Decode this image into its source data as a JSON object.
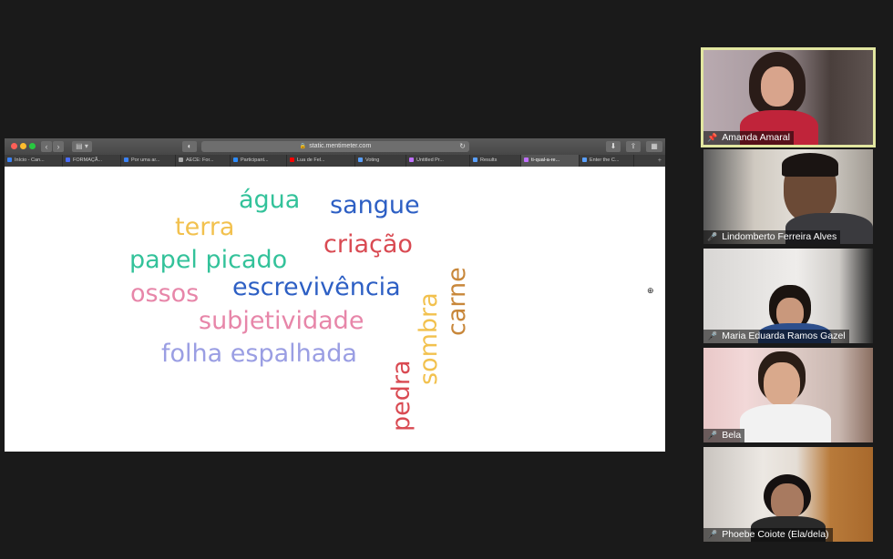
{
  "browser": {
    "url": "static.mentimeter.com",
    "tabs": [
      {
        "label": "Início - Can...",
        "color": "#3b82f6",
        "width": 64
      },
      {
        "label": "FORMAÇÃ...",
        "color": "#4a6cf7",
        "width": 64
      },
      {
        "label": "Por uma ar...",
        "color": "#3b82f6",
        "width": 60
      },
      {
        "label": "AECE: For...",
        "color": "#aaaaaa",
        "width": 60
      },
      {
        "label": "Participant...",
        "color": "#2d8cff",
        "width": 62
      },
      {
        "label": "Lua de Fel...",
        "color": "#ff0000",
        "width": 75
      },
      {
        "label": "Voting",
        "color": "#5aa0ff",
        "width": 56
      },
      {
        "label": "Untitled Pr...",
        "color": "#c070ff",
        "width": 70
      },
      {
        "label": "Results",
        "color": "#5aa0ff",
        "width": 56
      },
      {
        "label": "ti-qual-a-re...",
        "color": "#c070ff",
        "width": 64,
        "active": true
      },
      {
        "label": "Enter the C...",
        "color": "#5aa0ff",
        "width": 60
      }
    ],
    "tab_plus": "+"
  },
  "word_cloud": [
    {
      "text": "água",
      "color": "#33c29a"
    },
    {
      "text": "sangue",
      "color": "#2d5fc4"
    },
    {
      "text": "terra",
      "color": "#f2c14e"
    },
    {
      "text": "criação",
      "color": "#d94a52"
    },
    {
      "text": "papel picado",
      "color": "#33c29a"
    },
    {
      "text": "ossos",
      "color": "#e786a9"
    },
    {
      "text": "escrevivência",
      "color": "#2d5fc4"
    },
    {
      "text": "subjetividade",
      "color": "#e786a9"
    },
    {
      "text": "folha espalhada",
      "color": "#9a9ee3"
    },
    {
      "text": "carne",
      "color": "#c8873a"
    },
    {
      "text": "sombra",
      "color": "#f2c14e"
    },
    {
      "text": "pedra",
      "color": "#d94a52"
    }
  ],
  "participants": [
    {
      "name": "Amanda Amaral",
      "muted": false,
      "pinned": true
    },
    {
      "name": "Lindomberto Ferreira Alves",
      "muted": true
    },
    {
      "name": "Maria Eduarda Ramos Gazel",
      "muted": true
    },
    {
      "name": "Bela",
      "muted": true
    },
    {
      "name": "Phoebe Coiote (Ela/dela)",
      "muted": true
    }
  ],
  "icons": {
    "lock": "🔒",
    "reload": "↻",
    "zoom": "⊕",
    "mic_muted": "🎤",
    "pin": "📌"
  }
}
